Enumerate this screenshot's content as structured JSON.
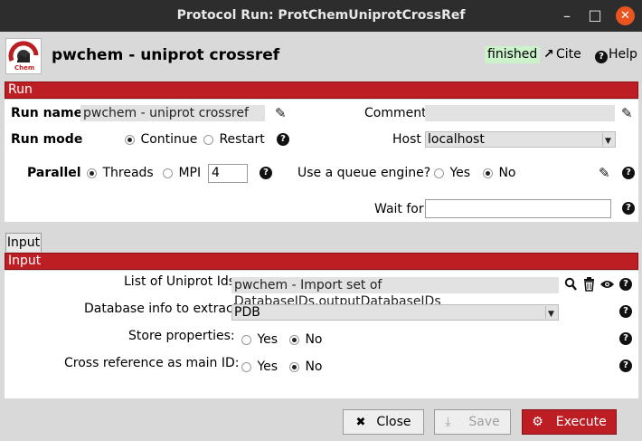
{
  "window": {
    "title": "Protocol Run: ProtChemUniprotCrossRef",
    "minimize_glyph": "–",
    "maximize_glyph": "□",
    "close_glyph": "✕"
  },
  "header": {
    "logo_text": "Chem",
    "app_title": "pwchem - uniprot crossref",
    "status": "finished",
    "cite_label": "Cite",
    "help_label": "Help"
  },
  "run": {
    "section_label": "Run",
    "run_name_label": "Run name",
    "run_name_value": "pwchem - uniprot crossref",
    "comment_label": "Comment",
    "comment_value": "",
    "run_mode_label": "Run mode",
    "run_mode_options": [
      "Continue",
      "Restart"
    ],
    "run_mode_selected": "Continue",
    "host_label": "Host",
    "host_value": "localhost",
    "parallel_label": "Parallel",
    "threads_label": "Threads",
    "mpi_label": "MPI",
    "mpi_value": "4",
    "queue_label": "Use a queue engine?",
    "queue_yes": "Yes",
    "queue_no": "No",
    "queue_selected": "No",
    "wait_for_label": "Wait for",
    "wait_for_value": ""
  },
  "input": {
    "tab_label": "Input",
    "section_label": "Input",
    "uniprot_label": "List of Uniprot Ids:",
    "uniprot_value": "pwchem - Import set of DatabaseIDs.outputDatabaseIDs",
    "dbinfo_label": "Database info to extract:",
    "dbinfo_value": "PDB",
    "store_label": "Store properties:",
    "store_yes": "Yes",
    "store_no": "No",
    "store_selected": "No",
    "crossref_label": "Cross reference as main ID:",
    "crossref_yes": "Yes",
    "crossref_no": "No",
    "crossref_selected": "No"
  },
  "footer": {
    "close_label": "Close",
    "save_label": "Save",
    "execute_label": "Execute"
  },
  "icons": {
    "help": "?",
    "pencil": "✎",
    "search": "⌕",
    "trash": "🗑",
    "eye": "👁",
    "close_x": "✖",
    "gear": "⚙",
    "save_arrow": "⤓",
    "external_link": "↗"
  },
  "colors": {
    "accent": "#bc1e24",
    "status_bg": "#ccf2cc",
    "titlebar": "#2d2d2d",
    "close_button": "#e95420"
  }
}
